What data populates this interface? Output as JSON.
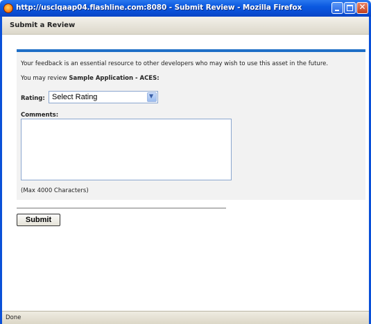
{
  "window": {
    "title": "http://usclqaap04.flashline.com:8080 - Submit Review - Mozilla Firefox"
  },
  "header": {
    "title": "Submit a Review"
  },
  "form": {
    "intro_line1": "Your feedback is an essential resource to other developers who may wish to use this asset in the future.",
    "intro_prefix": "You may review ",
    "asset_name": "Sample Application - ACES:",
    "rating_label": "Rating:",
    "rating_selected": "Select Rating",
    "comments_label": "Comments:",
    "comments_value": "",
    "max_chars_note": "(Max 4000 Characters)",
    "submit_label": "Submit"
  },
  "status": {
    "text": "Done"
  },
  "colors": {
    "titlebar": "#0a58e0",
    "accent_rule": "#1f6fc7",
    "panel": "#f2f2f2"
  }
}
